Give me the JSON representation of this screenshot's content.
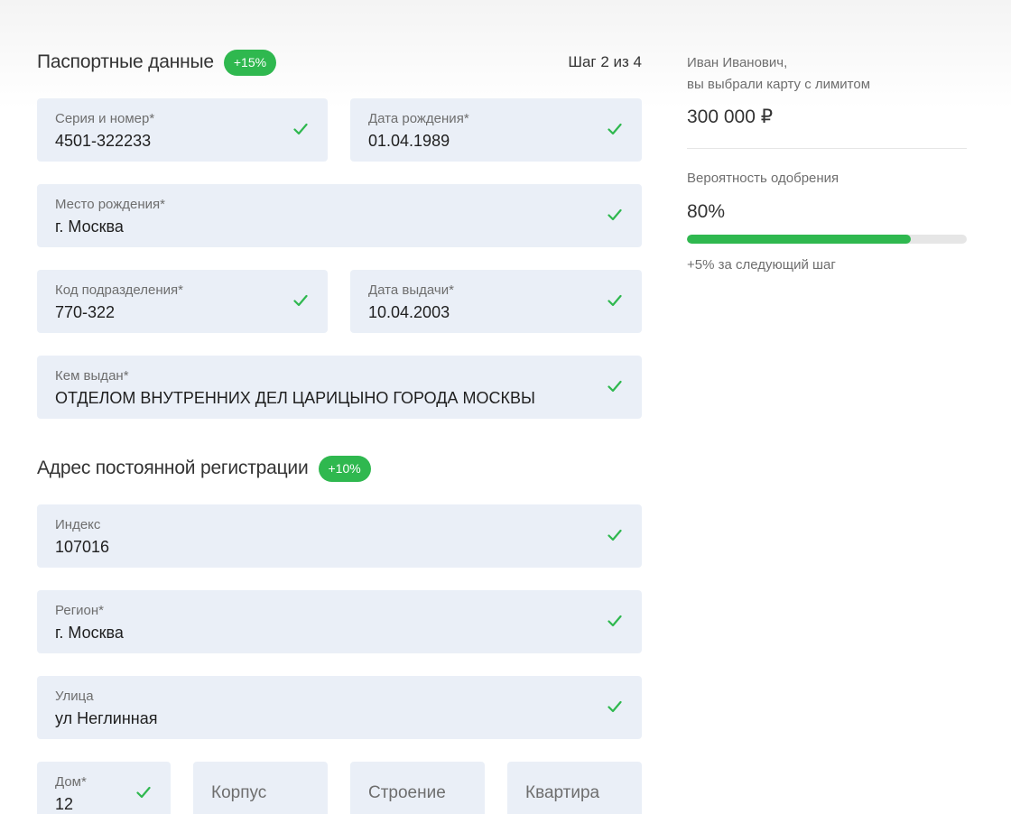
{
  "passport": {
    "title": "Паспортные данные",
    "badge": "+15%",
    "step": "Шаг 2 из 4",
    "series_number": {
      "label": "Серия и номер*",
      "value": "4501-322233"
    },
    "birth_date": {
      "label": "Дата рождения*",
      "value": "01.04.1989"
    },
    "birth_place": {
      "label": "Место рождения*",
      "value": "г. Москва"
    },
    "department_code": {
      "label": "Код подразделения*",
      "value": "770-322"
    },
    "issue_date": {
      "label": "Дата выдачи*",
      "value": "10.04.2003"
    },
    "issued_by": {
      "label": "Кем выдан*",
      "value": "ОТДЕЛОМ ВНУТРЕННИХ ДЕЛ ЦАРИЦЫНО ГОРОДА МОСКВЫ"
    }
  },
  "address": {
    "title": "Адрес постоянной регистрации",
    "badge": "+10%",
    "index": {
      "label": "Индекс",
      "value": "107016"
    },
    "region": {
      "label": "Регион*",
      "value": "г. Москва"
    },
    "street": {
      "label": "Улица",
      "value": "ул Неглинная"
    },
    "house": {
      "label": "Дом*",
      "value": "12"
    },
    "building": {
      "placeholder": "Корпус"
    },
    "structure": {
      "placeholder": "Строение"
    },
    "apartment": {
      "placeholder": "Квартира"
    }
  },
  "sidebar": {
    "greeting_line1": "Иван Иванович,",
    "greeting_line2": "вы выбрали карту с лимитом",
    "limit": "300 000 ₽",
    "probability_label": "Вероятность одобрения",
    "probability_value": "80%",
    "probability_fraction": 0.8,
    "next_step_bonus": "+5% за следующий шаг"
  },
  "colors": {
    "accent": "#2fb84f",
    "field_bg": "#eaeff7"
  },
  "icons": {
    "check": "check-icon"
  }
}
